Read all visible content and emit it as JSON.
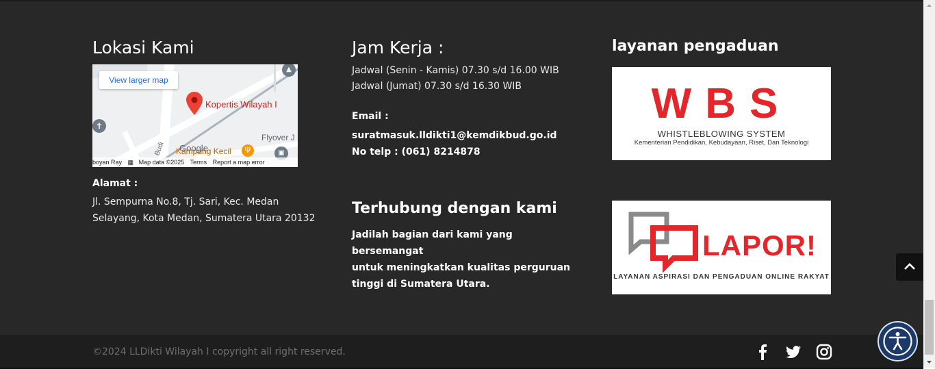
{
  "location": {
    "heading": "Lokasi Kami",
    "map": {
      "view_larger": "View larger map",
      "pin_label": "Kopertis Wilayah I",
      "flyover": "Flyover J",
      "poi": "Kampung Kecil",
      "google": "Google",
      "attrib_left": "boyan Ray",
      "map_data": "Map data ©2025",
      "terms": "Terms",
      "report": "Report a map error",
      "street": "Budi"
    },
    "address_label": "Alamat :",
    "address_line1": "Jl. Sempurna No.8, Tj. Sari, Kec. Medan",
    "address_line2": "Selayang, Kota Medan, Sumatera Utara 20132"
  },
  "hours": {
    "heading": "Jam Kerja :",
    "line1": "Jadwal (Senin - Kamis) 07.30 s/d 16.00 WIB",
    "line2": "Jadwal (Jumat) 07.30 s/d 16.30 WIB",
    "email_label": "Email :",
    "email": "suratmasuk.lldikti1@kemdikbud.go.id",
    "phone": "No telp : (061) 8214878"
  },
  "contact": {
    "heading": "Terhubung dengan kami",
    "line1": "Jadilah bagian dari kami yang bersemangat",
    "line2": "untuk meningkatkan kualitas perguruan",
    "line3": "tinggi di Sumatera Utara."
  },
  "complaints": {
    "heading": "layanan pengaduan",
    "wbs": {
      "letters": "WBS",
      "subtitle": "WHISTLEBLOWING SYSTEM",
      "subtitle2": "Kementerian Pendidikan, Kebudayaan, Riset, Dan Teknologi"
    },
    "lapor": {
      "title": "LAPOR!",
      "subtitle": "LAYANAN ASPIRASI DAN PENGADUAN ONLINE RAKYAT"
    }
  },
  "footer": {
    "copyright": "©2024 LLDikti Wilayah I copyright all right reserved.",
    "social": [
      "facebook-icon",
      "twitter-icon",
      "instagram-icon"
    ]
  },
  "colors": {
    "background": "#292828",
    "bottom_bar": "#1f1e1e",
    "accent_red": "#e4262a",
    "accessibility": "#1b3a6a"
  }
}
